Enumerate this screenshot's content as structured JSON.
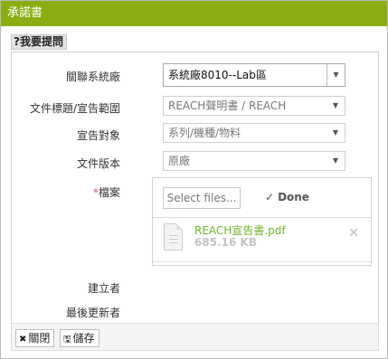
{
  "window": {
    "title": "承諾書"
  },
  "help_button": "?我要提問",
  "form": {
    "related_factory": {
      "label": "關聯系統廠",
      "value": "系統廠8010--Lab區"
    },
    "doc_title": {
      "label": "文件標題/宣告範圍",
      "value": "REACH聲明書 / REACH"
    },
    "declaration_target": {
      "label": "宣告對象",
      "value": "系列/機種/物料"
    },
    "doc_version": {
      "label": "文件版本",
      "value": "原廠"
    },
    "file": {
      "required_mark": "*",
      "label": "檔案",
      "select_files": "Select files...",
      "done": "Done",
      "files": [
        {
          "name": "REACH宣告書.pdf",
          "size": "685.16 KB"
        }
      ]
    },
    "creator": {
      "label": "建立者"
    },
    "last_updater": {
      "label": "最後更新者"
    }
  },
  "footer": {
    "close_label": "關閉",
    "save_label": "儲存"
  },
  "colors": {
    "titlebar": "#8aae12",
    "file_name": "#73b52a",
    "required": "#d9534f"
  }
}
